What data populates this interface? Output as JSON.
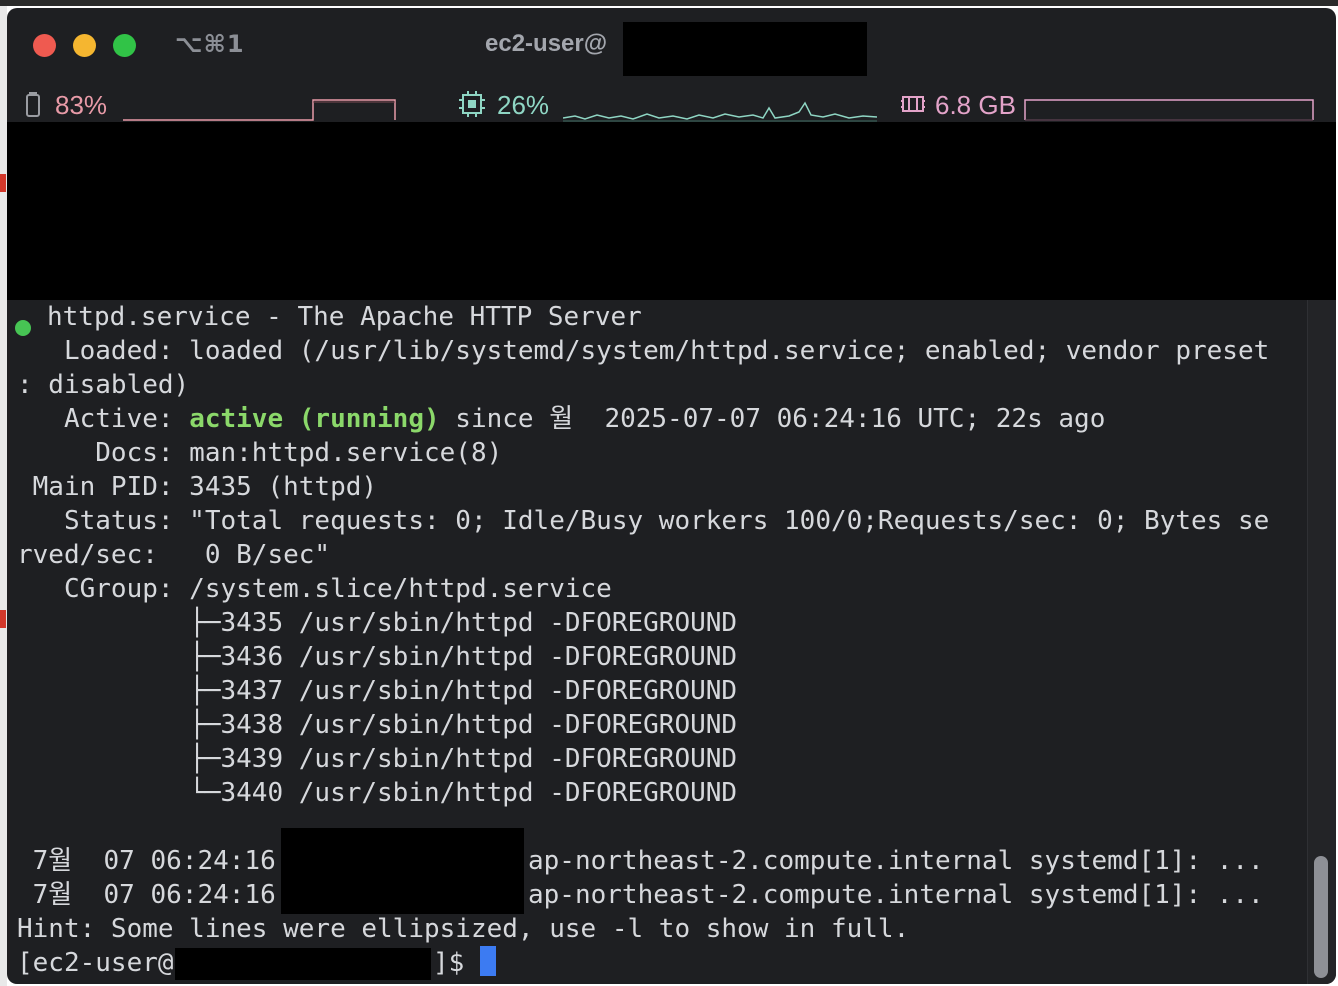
{
  "window": {
    "shortcut": "⌥⌘1",
    "title": "ec2-user@"
  },
  "status_bar": {
    "battery": {
      "icon": "battery-icon",
      "value": "83%",
      "color": "#e79aa7"
    },
    "cpu": {
      "icon": "cpu-icon",
      "value": "26%",
      "color": "#8fd6c4"
    },
    "memory": {
      "icon": "memory-icon",
      "value": "6.8 GB",
      "color": "#e3a3c9"
    }
  },
  "terminal": {
    "service_line": "httpd.service - The Apache HTTP Server",
    "loaded_line_1": "   Loaded: loaded (/usr/lib/systemd/system/httpd.service; enabled; vendor preset",
    "loaded_line_2": ": disabled)",
    "active_label": "   Active: ",
    "active_state": "active (running)",
    "active_rest": " since 월  2025-07-07 06:24:16 UTC; 22s ago",
    "docs_line": "     Docs: man:httpd.service(8)",
    "main_pid_line": " Main PID: 3435 (httpd)",
    "status_line_1": "   Status: \"Total requests: 0; Idle/Busy workers 100/0;Requests/sec: 0; Bytes se",
    "status_line_2": "rved/sec:   0 B/sec\"",
    "cgroup_line": "   CGroup: /system.slice/httpd.service",
    "processes": [
      "           ├─3435 /usr/sbin/httpd -DFOREGROUND",
      "           ├─3436 /usr/sbin/httpd -DFOREGROUND",
      "           ├─3437 /usr/sbin/httpd -DFOREGROUND",
      "           ├─3438 /usr/sbin/httpd -DFOREGROUND",
      "           ├─3439 /usr/sbin/httpd -DFOREGROUND",
      "           └─3440 /usr/sbin/httpd -DFOREGROUND"
    ],
    "log_lines": [
      {
        "time": " 7월  07 06:24:16 ",
        "rest": "ap-northeast-2.compute.internal systemd[1]: ..."
      },
      {
        "time": " 7월  07 06:24:16 ",
        "rest": "ap-northeast-2.compute.internal systemd[1]: ..."
      }
    ],
    "hint_line": "Hint: Some lines were ellipsized, use -l to show in full.",
    "prompt_start": "[ec2-user@",
    "prompt_end": "]$ "
  }
}
